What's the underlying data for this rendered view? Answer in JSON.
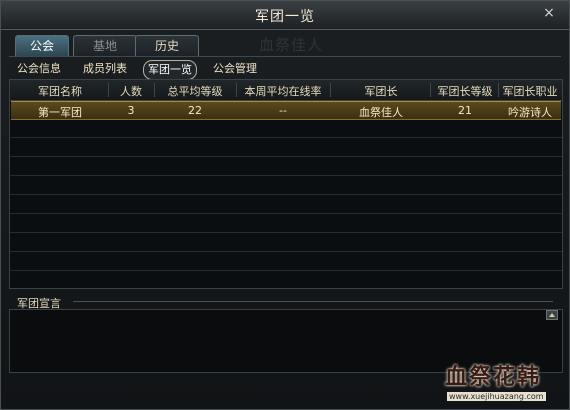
{
  "window": {
    "title": "军团一览",
    "close": "×",
    "ghost_text": "血祭佳人"
  },
  "tabs": [
    {
      "label": "公会",
      "state": "active"
    },
    {
      "label": "基地",
      "state": "disabled"
    },
    {
      "label": "历史",
      "state": "normal"
    }
  ],
  "subnav": [
    {
      "label": "公会信息"
    },
    {
      "label": "成员列表"
    },
    {
      "label": "军团一览",
      "active": true
    },
    {
      "label": "公会管理"
    }
  ],
  "table": {
    "columns": [
      "军团名称",
      "人数",
      "总平均等级",
      "本周平均在线率",
      "军团长",
      "军团长等级",
      "军团长职业"
    ],
    "rows": [
      [
        "第一军团",
        "3",
        "22",
        "--",
        "血祭佳人",
        "21",
        "吟游诗人"
      ]
    ]
  },
  "declaration": {
    "label": "军团宣言",
    "text": ""
  },
  "watermark": {
    "title": "血祭花韩",
    "url": "www.xuejihuazang.com"
  },
  "colors": {
    "selected_row": "#5c4a1c",
    "active_tab": "#4c7080"
  }
}
